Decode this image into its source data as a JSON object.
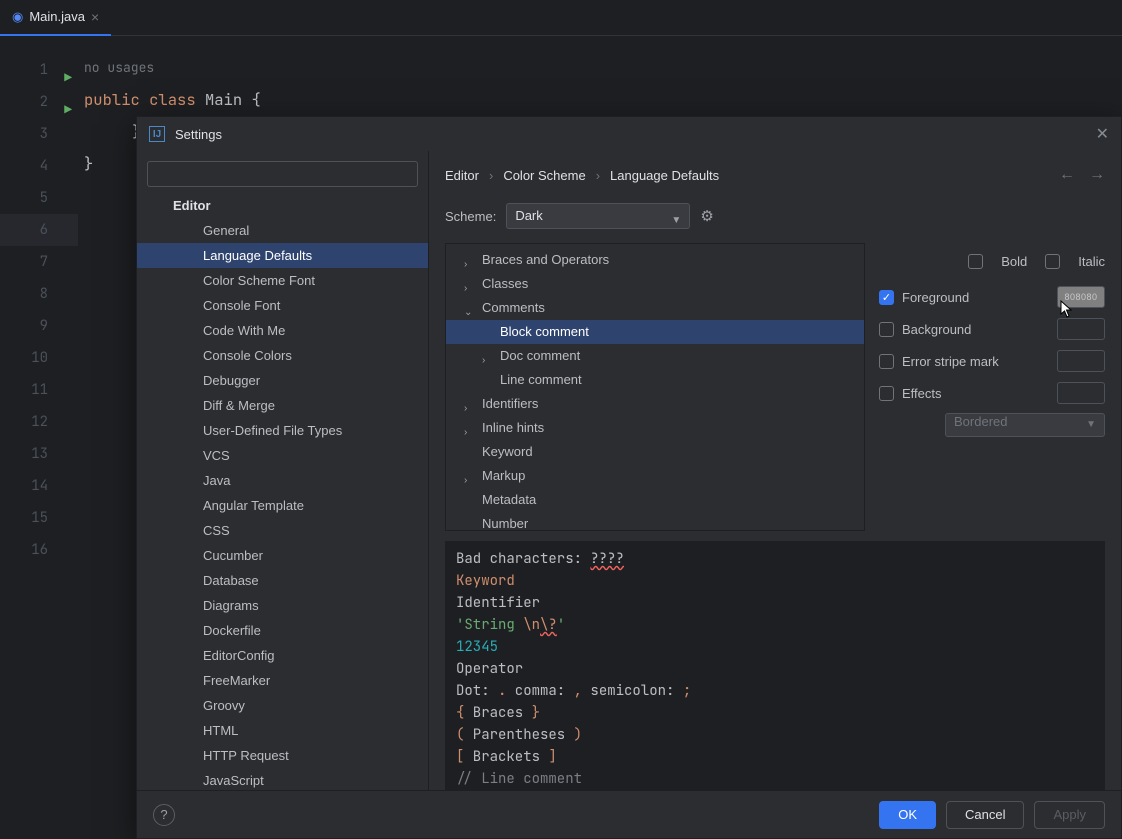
{
  "tab": {
    "filename": "Main.java"
  },
  "editor": {
    "usages": "no usages",
    "line1_kw1": "public",
    "line1_kw2": "class",
    "line1_cls": "Main",
    "line1_br": "{",
    "brace_close": "}"
  },
  "gutter_lines": [
    "1",
    "2",
    "3",
    "4",
    "5",
    "6",
    "7",
    "8",
    "9",
    "10",
    "11",
    "12",
    "13",
    "14",
    "15",
    "16"
  ],
  "dialog": {
    "title": "Settings",
    "breadcrumb": [
      "Editor",
      "Color Scheme",
      "Language Defaults"
    ],
    "scheme_label": "Scheme:",
    "scheme_value": "Dark",
    "sidebar_header": "Editor",
    "sidebar_items": [
      "General",
      "Language Defaults",
      "Color Scheme Font",
      "Console Font",
      "Code With Me",
      "Console Colors",
      "Debugger",
      "Diff & Merge",
      "User-Defined File Types",
      "VCS",
      "Java",
      "Angular Template",
      "CSS",
      "Cucumber",
      "Database",
      "Diagrams",
      "Dockerfile",
      "EditorConfig",
      "FreeMarker",
      "Groovy",
      "HTML",
      "HTTP Request",
      "JavaScript"
    ],
    "sidebar_selected": "Language Defaults",
    "ld_tree": [
      {
        "label": "Braces and Operators",
        "lvl": 0,
        "exp": ">"
      },
      {
        "label": "Classes",
        "lvl": 0,
        "exp": ">"
      },
      {
        "label": "Comments",
        "lvl": 0,
        "exp": "v"
      },
      {
        "label": "Block comment",
        "lvl": 1,
        "exp": "",
        "sel": true
      },
      {
        "label": "Doc comment",
        "lvl": 1,
        "exp": ">"
      },
      {
        "label": "Line comment",
        "lvl": 1,
        "exp": ""
      },
      {
        "label": "Identifiers",
        "lvl": 0,
        "exp": ">"
      },
      {
        "label": "Inline hints",
        "lvl": 0,
        "exp": ">"
      },
      {
        "label": "Keyword",
        "lvl": 0,
        "exp": ""
      },
      {
        "label": "Markup",
        "lvl": 0,
        "exp": ">"
      },
      {
        "label": "Metadata",
        "lvl": 0,
        "exp": ""
      },
      {
        "label": "Number",
        "lvl": 0,
        "exp": ""
      }
    ],
    "props": {
      "bold": "Bold",
      "italic": "Italic",
      "foreground": "Foreground",
      "fg_hex": "808080",
      "background": "Background",
      "error_stripe": "Error stripe mark",
      "effects": "Effects",
      "effects_value": "Bordered"
    },
    "preview": {
      "l1a": "Bad characters: ",
      "l1b": "????",
      "l2": "Keyword",
      "l3": "Identifier",
      "l4a": "'String ",
      "l4b": "\\n",
      "l4c": "\\?",
      "l4d": "'",
      "l5": "12345",
      "l6": "Operator",
      "l7a": "Dot: ",
      "l7b": ".",
      "l7c": " comma: ",
      "l7d": ",",
      "l7e": " semicolon: ",
      "l7f": ";",
      "l8a": "{",
      "l8b": " Braces ",
      "l8c": "}",
      "l9a": "(",
      "l9b": " Parentheses ",
      "l9c": ")",
      "l10a": "[",
      "l10b": " Brackets ",
      "l10c": "]",
      "l11": "// Line comment"
    },
    "buttons": {
      "ok": "OK",
      "cancel": "Cancel",
      "apply": "Apply"
    }
  }
}
